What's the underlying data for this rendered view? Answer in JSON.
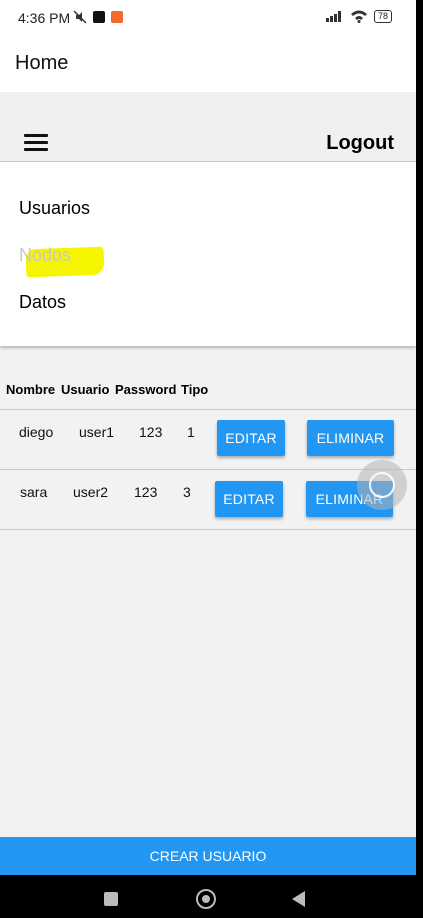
{
  "status_bar": {
    "time": "4:36 PM",
    "battery": "78",
    "left_icons": [
      "mute-icon",
      "app-notification-icon",
      "orange-app-icon"
    ],
    "right_icons": [
      "signal-icon",
      "wifi-icon",
      "battery-icon"
    ]
  },
  "app_bar": {
    "title": "Home"
  },
  "header": {
    "logout_label": "Logout",
    "menu_icon": "hamburger-icon"
  },
  "drawer": {
    "items": [
      {
        "label": "Usuarios",
        "active": false
      },
      {
        "label": "Nodos",
        "active": true
      },
      {
        "label": "Datos",
        "active": false
      }
    ],
    "highlight_color": "#f5f500"
  },
  "table": {
    "headers": [
      "Nombre",
      "Usuario",
      "Password",
      "Tipo"
    ],
    "rows": [
      {
        "nombre": "diego",
        "usuario": "user1",
        "password": "123",
        "tipo": "1",
        "edit_label": "EDITAR",
        "delete_label": "ELIMINAR"
      },
      {
        "nombre": "sara",
        "usuario": "user2",
        "password": "123",
        "tipo": "3",
        "edit_label": "EDITAR",
        "delete_label": "ELIMINAR"
      }
    ]
  },
  "footer": {
    "create_label": "CREAR USUARIO"
  },
  "colors": {
    "accent": "#2196f3",
    "background": "#f2f2f2",
    "inactive_text": "#c9c9c9"
  },
  "nav_bar": {
    "icons": [
      "recents-square-icon",
      "home-circle-icon",
      "back-triangle-icon"
    ]
  }
}
